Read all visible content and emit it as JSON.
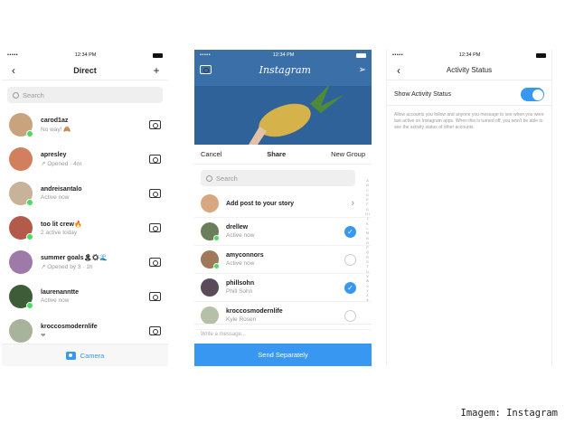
{
  "statusbar": {
    "time": "12:34 PM",
    "signal": "•••••"
  },
  "direct": {
    "back_icon": "chevron-left-icon",
    "title": "Direct",
    "new_icon": "plus-icon",
    "search_placeholder": "Search",
    "threads": [
      {
        "name": "carod1az",
        "sub": "No way! 🙈",
        "online": true,
        "color": "#c9a27e"
      },
      {
        "name": "apresley",
        "sub": "↗ Opened · 4m",
        "online": false,
        "color": "#d27f5f"
      },
      {
        "name": "andreisantalo",
        "sub": "Active now",
        "online": true,
        "color": "#c8b39a"
      },
      {
        "name": "too lit crew🔥",
        "sub": "2 active today",
        "online": true,
        "color": "#b45a4a"
      },
      {
        "name": "summer goals🏝☀🌊",
        "sub": "↗ Opened by 3 · 1h",
        "online": false,
        "color": "#9d7aa8"
      },
      {
        "name": "laurenanntte",
        "sub": "Active now",
        "online": true,
        "color": "#3e5c37"
      },
      {
        "name": "kroccosmodernlife",
        "sub": "❤",
        "online": false,
        "color": "#a8b39c"
      }
    ],
    "camera_label": "Camera"
  },
  "share": {
    "logo": "Instagram",
    "cancel": "Cancel",
    "title": "Share",
    "new_group": "New Group",
    "search_placeholder": "Search",
    "story_label": "Add post to your story",
    "recipients": [
      {
        "name": "drellew",
        "sub": "Active now",
        "online": true,
        "checked": true,
        "color": "#6b7d5a"
      },
      {
        "name": "amyconnors",
        "sub": "Active now",
        "online": true,
        "checked": false,
        "color": "#a0785a"
      },
      {
        "name": "phillsohn",
        "sub": "Phill Sohn",
        "online": false,
        "checked": true,
        "color": "#5a4a5a"
      },
      {
        "name": "kroccosmodernlife",
        "sub": "Kyle Rosen",
        "online": false,
        "checked": false,
        "color": "#b5c0a8"
      }
    ],
    "alphabet": "A B C D E F G H I J K L M N O P Q R S T U V W X Y Z #",
    "message_placeholder": "Write a message...",
    "send_label": "Send Separately"
  },
  "activity": {
    "title": "Activity Status",
    "setting_label": "Show Activity Status",
    "toggle_on": true,
    "description": "Allow accounts you follow and anyone you message to see when you were last active on Instagram apps. When this is turned off, you won't be able to see the activity status of other accounts."
  },
  "caption": "Imagem: Instagram",
  "colors": {
    "accent": "#3897f0",
    "online": "#4cd964",
    "hero_bg": "#3a6fa7"
  }
}
